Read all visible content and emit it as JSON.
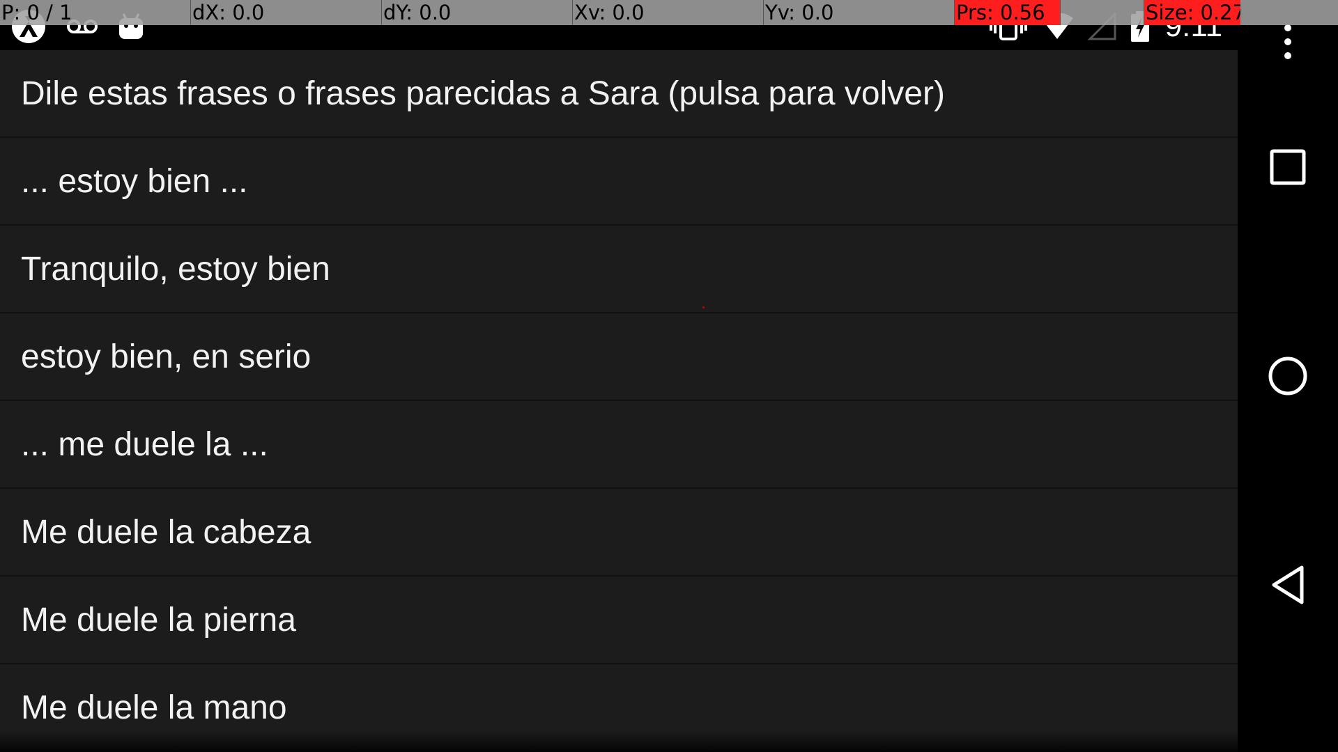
{
  "pointer_overlay": {
    "p": "P: 0 / 1",
    "dx": "dX: 0.0",
    "dy": "dY: 0.0",
    "xv": "Xv: 0.0",
    "yv": "Yv: 0.0",
    "prs": "Prs: 0.56",
    "size": "Size: 0.27",
    "alert_color": "#ff1e1e"
  },
  "status_bar": {
    "left_icons": [
      "notification-app-icon",
      "voicemail-icon",
      "android-icon"
    ],
    "right_icons": [
      "vibrate-icon",
      "wifi-icon",
      "cell-signal-icon",
      "battery-charging-icon"
    ],
    "clock": "9:11"
  },
  "list": {
    "items": [
      "Dile estas frases o frases parecidas a Sara (pulsa para volver)",
      "... estoy bien ...",
      "Tranquilo, estoy bien",
      "estoy bien, en serio",
      "... me duele la ...",
      "Me duele la cabeza",
      "Me duele la pierna",
      "Me duele la mano"
    ]
  },
  "nav_bar": {
    "buttons": [
      "overflow-menu-icon",
      "recents-icon",
      "home-icon",
      "back-icon"
    ]
  },
  "colors": {
    "list_background": "#1c1c1c",
    "text": "#f2f2f2",
    "overlay_background": "#a0a0a0"
  }
}
